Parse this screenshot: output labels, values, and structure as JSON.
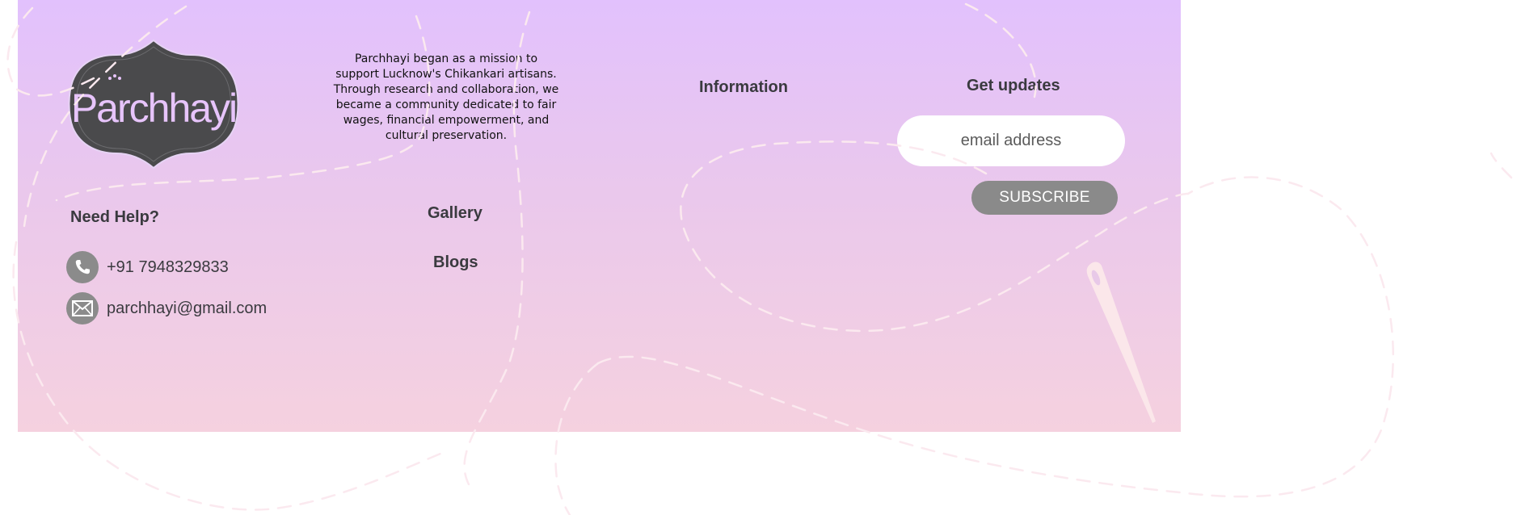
{
  "brand": {
    "logo_text": "Parchhayi",
    "colors": {
      "gradient_top": "#e2c1fd",
      "gradient_bottom": "#f5d1df",
      "logo_plate": "#4a4a4c",
      "logo_letters": "#e7c4fb",
      "button": "#8a8a8a",
      "stitch": "#fbe9ef"
    }
  },
  "about": {
    "text": "Parchhayi began as a mission to support Lucknow's Chikankari artisans. Through research and collaboration, we became a community dedicated to fair wages, financial empowerment, and cultural preservation."
  },
  "info": {
    "title": "Information"
  },
  "newsletter": {
    "title": "Get updates",
    "email_placeholder": "email address",
    "email_value": "",
    "subscribe_label": "SUBSCRIBE"
  },
  "help": {
    "title": "Need Help?",
    "phone": "+91 7948329833",
    "email": "parchhayi@gmail.com",
    "phone_icon": "phone-icon",
    "email_icon": "envelope-icon"
  },
  "nav": {
    "gallery": "Gallery",
    "blogs": "Blogs"
  },
  "decor": {
    "needle_icon": "needle-icon"
  }
}
